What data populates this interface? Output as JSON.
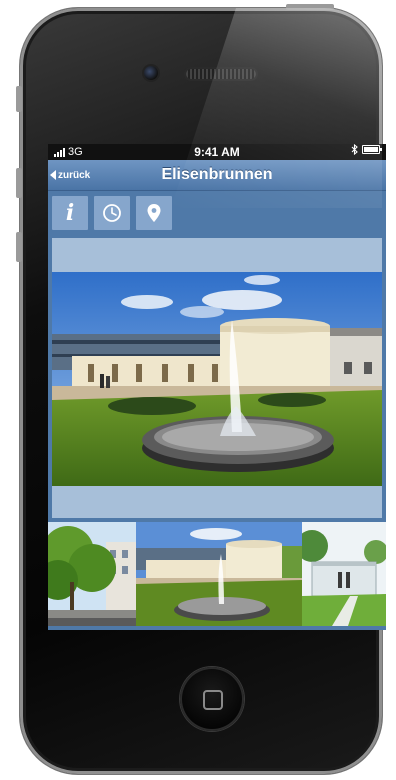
{
  "status": {
    "carrier": "3G",
    "time": "9:41 AM",
    "bluetooth": "bluetooth-icon",
    "battery": "battery-icon"
  },
  "nav": {
    "back_label": "zurück",
    "title": "Elisenbrunnen"
  },
  "toolbar": {
    "buttons": [
      {
        "icon": "info-icon",
        "glyph": "i"
      },
      {
        "icon": "clock-icon"
      },
      {
        "icon": "map-pin-icon"
      }
    ]
  },
  "colors": {
    "screen_bg": "#4f79a8",
    "nav_bar": "#5a82b3",
    "panel": "#a7bfd9",
    "tool_button": "#86a6cc"
  },
  "images": {
    "main_photo": "elisenbrunnen-fountain-photo",
    "thumbnails": [
      "street-trees-thumbnail",
      "elisenbrunnen-fountain-thumbnail",
      "park-pavilion-thumbnail"
    ]
  }
}
